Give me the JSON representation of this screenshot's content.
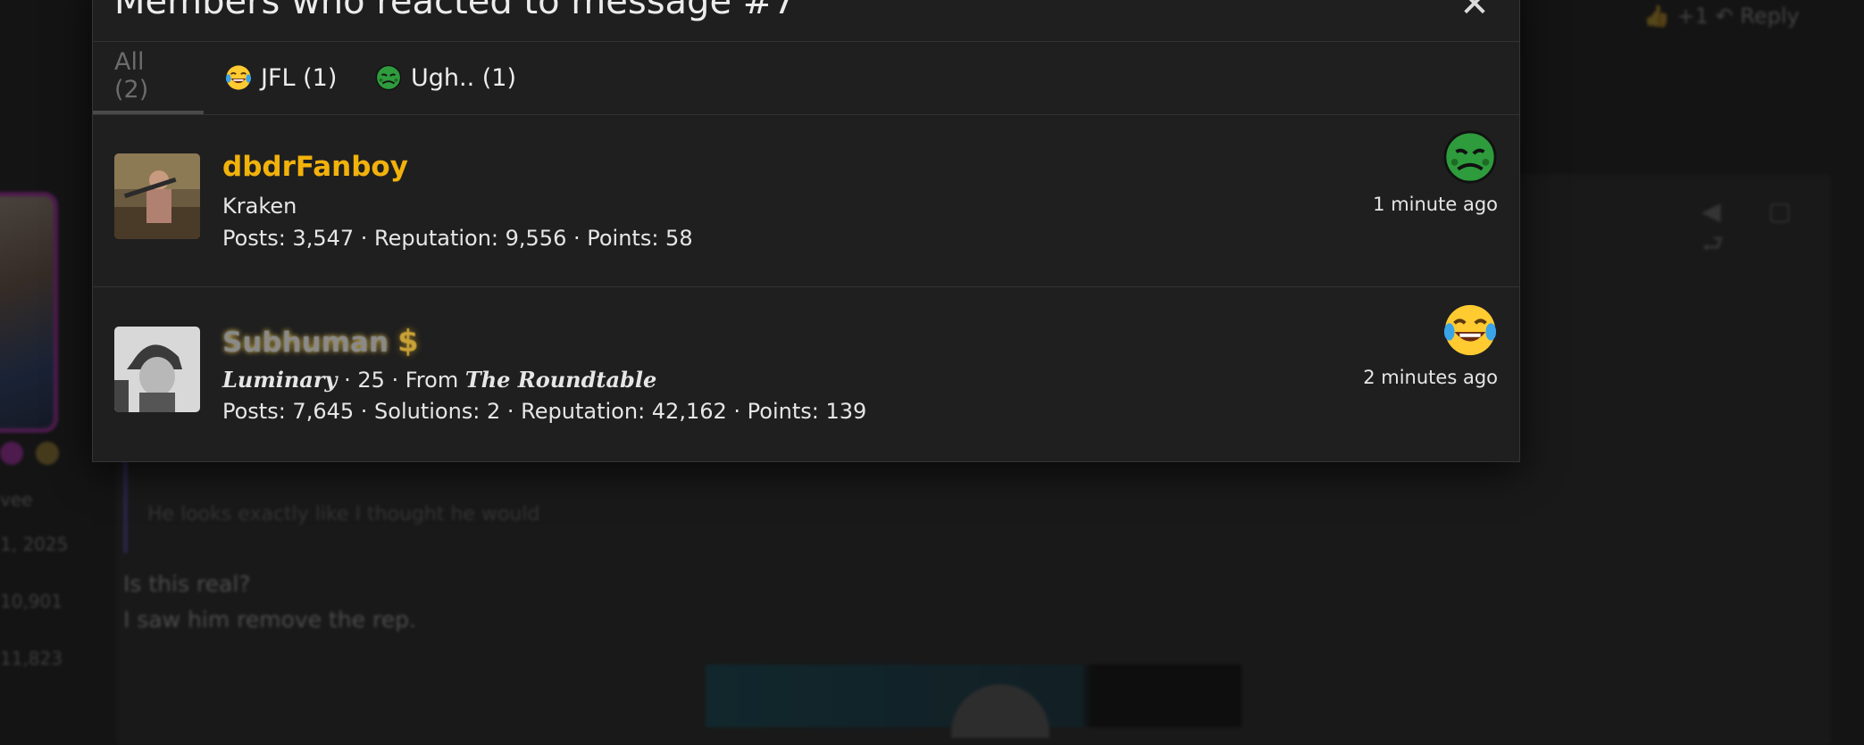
{
  "background": {
    "top_actions": "👍 +1   ↶ Reply",
    "quote_text": "He looks exactly like I thought he would",
    "post_lines": [
      "Is this real?",
      "I saw him remove the rep."
    ],
    "stats": [
      "vee",
      "1, 2025",
      "10,901",
      "11,823"
    ]
  },
  "modal": {
    "title": "Members who reacted to message #7",
    "close_label": "✕"
  },
  "tabs": [
    {
      "label": "All (2)",
      "emoji": ""
    },
    {
      "label": "JFL (1)",
      "emoji": "joy-emoji"
    },
    {
      "label": "Ugh.. (1)",
      "emoji": "nauseated-emoji"
    }
  ],
  "members": [
    {
      "username": "dbdrFanboy",
      "title": "Kraken",
      "stats": "Posts: 3,547 · Reputation: 9,556 · Points: 58",
      "reaction": "nauseated-emoji",
      "time": "1 minute ago"
    },
    {
      "username": "Subhuman",
      "badge": "$",
      "title_rank": "Luminary",
      "title_mid": " · 25 · From ",
      "title_place": "The Roundtable",
      "stats": "Posts: 7,645 · Solutions: 2 · Reputation: 42,162 · Points: 139",
      "reaction": "joy-emoji",
      "time": "2 minutes ago"
    }
  ],
  "colors": {
    "username_gold": "#f2b20c",
    "modal_bg": "#1f1f1f",
    "page_bg": "#141414"
  }
}
